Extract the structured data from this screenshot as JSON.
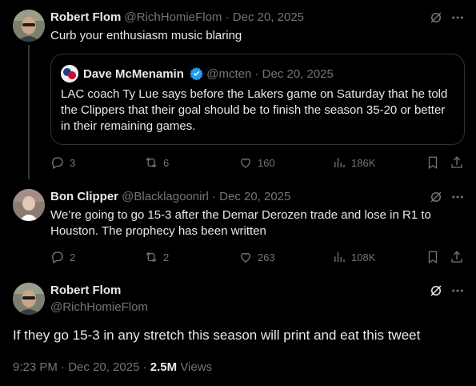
{
  "tweet1": {
    "name": "Robert Flom",
    "handle": "@RichHomieFlom",
    "sep": "·",
    "date": "Dec 20, 2025",
    "text": "Curb your enthusiasm music blaring",
    "quote": {
      "name": "Dave McMenamin",
      "handle": "@mcten",
      "sep": "·",
      "date": "Dec 20, 2025",
      "text": "LAC coach Ty Lue says before the Lakers game on Saturday that he told the Clippers that their goal should be to finish the season 35-20 or better in their remaining games."
    },
    "replies": "3",
    "reposts": "6",
    "likes": "160",
    "views": "186K"
  },
  "tweet2": {
    "name": "Bon Clipper",
    "handle": "@Blacklagoonirl",
    "sep": "·",
    "date": "Dec 20, 2025",
    "text": "We’re going to go 15-3 after the Demar Derozen trade and lose in R1 to Houston. The prophecy has been written",
    "replies": "2",
    "reposts": "2",
    "likes": "263",
    "views": "108K"
  },
  "main": {
    "name": "Robert Flom",
    "handle": "@RichHomieFlom",
    "text": "If they go 15-3 in any stretch this season will print and eat this tweet",
    "time": "9:23 PM",
    "sep": "·",
    "date": "Dec 20, 2025",
    "views_count": "2.5M",
    "views_label": "Views"
  },
  "icons": {
    "reply": "reply-icon",
    "repost": "repost-icon",
    "like": "heart-icon",
    "views": "analytics-icon",
    "bookmark": "bookmark-icon",
    "share": "share-icon",
    "grok": "grok-icon",
    "more": "more-icon",
    "verified": "verified-badge-icon"
  },
  "colors": {
    "background": "#000000",
    "text": "#e7e9ea",
    "muted": "#71767b",
    "border": "#2f3336",
    "verified": "#1d9bf0"
  }
}
